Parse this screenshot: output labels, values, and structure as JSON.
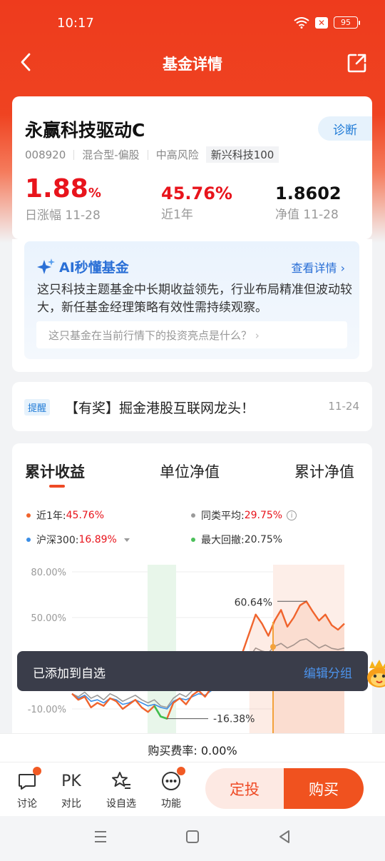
{
  "status": {
    "time": "10:17",
    "battery": "95"
  },
  "nav": {
    "title": "基金详情"
  },
  "fund": {
    "name": "永赢科技驱动C",
    "diagnose": "诊断",
    "code": "008920",
    "type": "混合型-偏股",
    "risk": "中高风险",
    "tag": "新兴科技100",
    "daily_change": "1.88",
    "daily_unit": "%",
    "daily_label": "日涨幅 11-28",
    "year_return": "45.76%",
    "year_label": "近1年",
    "nav_value": "1.8602",
    "nav_label": "净值 11-28"
  },
  "ai": {
    "title": "AI秒懂基金",
    "more": "查看详情",
    "summary": "这只科技主题基金中长期收益领先，行业布局精准但波动较大，新任基金经理策略有效性需持续观察。",
    "question": "这只基金在当前行情下的投资亮点是什么？"
  },
  "notice": {
    "tag": "提醒",
    "text": "【有奖】掘金港股互联网龙头！",
    "date": "11-24"
  },
  "chart_tabs": [
    "累计收益",
    "单位净值",
    "累计净值"
  ],
  "legend": {
    "fund_label": "近1年:",
    "fund_value": "45.76%",
    "peer_label": "同类平均:",
    "peer_value": "29.75%",
    "index_label": "沪深300:",
    "index_value": "16.89%",
    "drawdown_label": "最大回撤:",
    "drawdown_value": "20.75%"
  },
  "chart_data": {
    "type": "line",
    "y_ticks": [
      "80.00%",
      "50.00%",
      "-10.00%"
    ],
    "annotations": {
      "high": "60.64%",
      "low": "-16.38%"
    },
    "series": [
      {
        "name": "近1年",
        "color": "#f0642d",
        "values": [
          0,
          -4,
          -2,
          -9,
          -6,
          -8,
          -3,
          -5,
          -10,
          -7,
          -4,
          -9,
          -12,
          -8,
          -15,
          -16.38,
          -6,
          -3,
          -7,
          -1,
          2,
          -2,
          4,
          6,
          10,
          14,
          22,
          28,
          40,
          52,
          46,
          38,
          48,
          55,
          44,
          50,
          58,
          60.64,
          54,
          48,
          52,
          45,
          42,
          46
        ]
      },
      {
        "name": "同类平均",
        "color": "#9a9a9a",
        "values": [
          0,
          -2,
          1,
          -3,
          -1,
          -4,
          0,
          -2,
          -5,
          -3,
          -1,
          -4,
          -6,
          -4,
          -8,
          -9,
          -3,
          0,
          -2,
          2,
          4,
          3,
          6,
          8,
          10,
          13,
          17,
          20,
          24,
          30,
          28,
          27,
          31,
          33,
          30,
          32,
          35,
          36,
          33,
          30,
          32,
          29.75,
          29,
          30
        ]
      },
      {
        "name": "沪深300",
        "color": "#3b8ee6",
        "values": [
          0,
          -3,
          -1,
          -5,
          -4,
          -6,
          -3,
          -4,
          -7,
          -6,
          -4,
          -6,
          -8,
          -7,
          -9,
          -10,
          -5,
          -3,
          -4,
          -2,
          0,
          -1,
          2,
          3,
          5,
          6,
          8,
          10,
          12,
          14,
          13,
          12,
          14,
          16,
          14,
          15,
          17,
          18,
          16,
          15,
          16,
          16.89,
          16,
          17
        ]
      }
    ]
  },
  "toast": {
    "message": "已添加到自选",
    "action": "编辑分组"
  },
  "fee": {
    "text": "购买费率: 0.00%"
  },
  "bottom": {
    "discuss": "讨论",
    "pk_icon": "PK",
    "compare": "对比",
    "watch": "设自选",
    "func": "功能",
    "dingtou": "定投",
    "buy": "购买"
  }
}
